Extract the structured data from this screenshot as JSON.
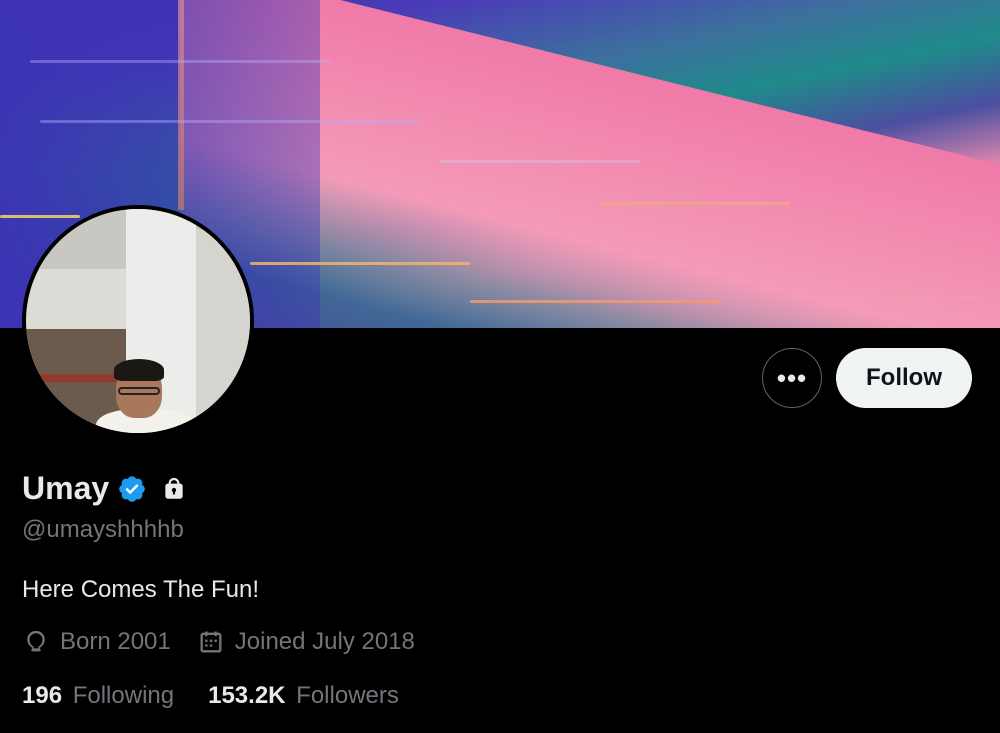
{
  "profile": {
    "display_name": "Umay",
    "handle": "@umayshhhhb",
    "bio": "Here Comes The Fun!",
    "verified": true,
    "protected": true,
    "birth_label": "Born 2001",
    "joined_label": "Joined July 2018"
  },
  "actions": {
    "more_label": "•••",
    "follow_label": "Follow"
  },
  "stats": {
    "following_count": "196",
    "following_label": "Following",
    "followers_count": "153.2K",
    "followers_label": "Followers"
  },
  "icons": {
    "verified": "verified-badge-icon",
    "protected": "lock-icon",
    "birth": "balloon-icon",
    "joined": "calendar-icon"
  },
  "colors": {
    "background": "#000000",
    "text_primary": "#e7e9ea",
    "text_secondary": "#71767b",
    "verified_blue": "#1d9bf0",
    "follow_button_bg": "#eff3f4"
  }
}
